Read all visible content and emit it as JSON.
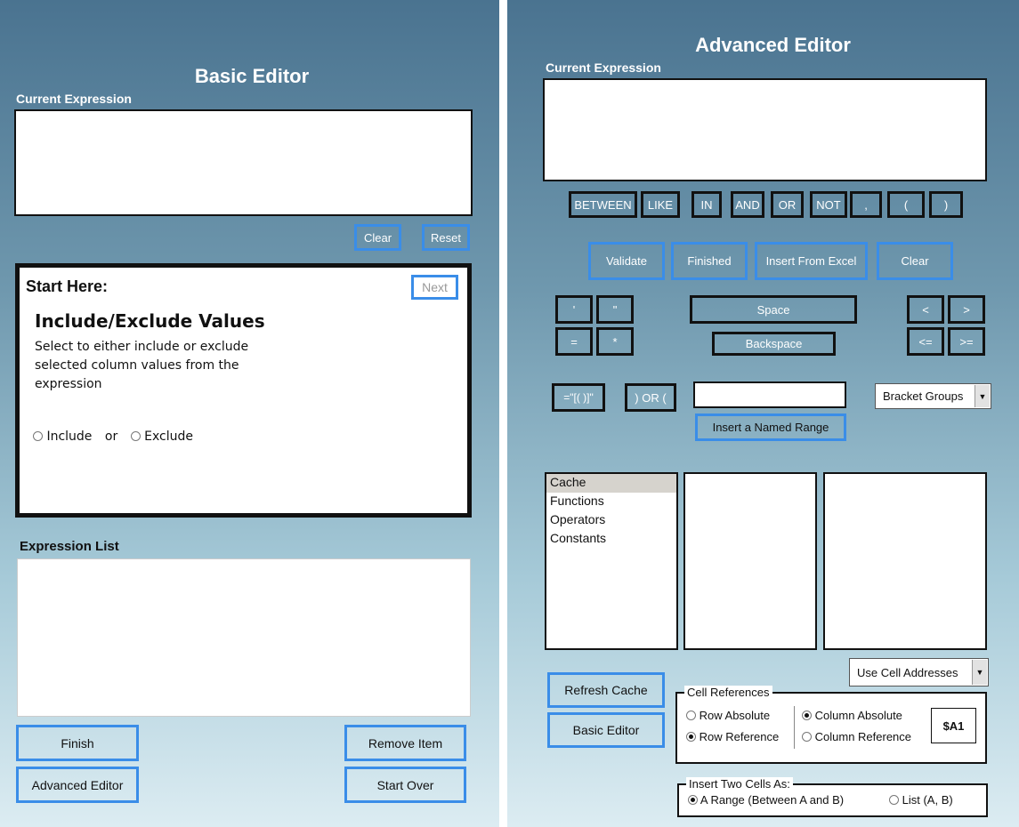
{
  "basic": {
    "title": "Basic Editor",
    "current_expression_label": "Current Expression",
    "clear_label": "Clear",
    "reset_label": "Reset",
    "start_here": "Start Here:",
    "next_label": "Next",
    "step_title": "Include/Exclude Values",
    "step_desc": "Select to either include or exclude selected column values from the expression",
    "include_label": "Include",
    "or_label": "or",
    "exclude_label": "Exclude",
    "expression_list_label": "Expression List",
    "finish_label": "Finish",
    "remove_item_label": "Remove Item",
    "advanced_editor_label": "Advanced Editor",
    "start_over_label": "Start Over"
  },
  "advanced": {
    "title": "Advanced Editor",
    "current_expression_label": "Current Expression",
    "operators": [
      "BETWEEN",
      "LIKE",
      "IN",
      "AND",
      "OR",
      "NOT",
      ",",
      "(",
      ")"
    ],
    "validate_label": "Validate",
    "finished_label": "Finished",
    "insert_from_excel_label": "Insert From Excel",
    "clear_label": "Clear",
    "quote_single": "'",
    "quote_double": "\"",
    "equals": "=",
    "star": "*",
    "space_label": "Space",
    "backspace_label": "Backspace",
    "lt": "<",
    "gt": ">",
    "lte": "<=",
    "gte": ">=",
    "bracket_insert": "=\"[( )]\"",
    "or_paren": ") OR (",
    "named_range_value": "",
    "bracket_groups_label": "Bracket Groups",
    "insert_named_range_label": "Insert a Named Range",
    "list_items": [
      "Cache",
      "Functions",
      "Operators",
      "Constants"
    ],
    "use_cell_addresses_label": "Use Cell Addresses",
    "refresh_cache_label": "Refresh Cache",
    "basic_editor_label": "Basic Editor",
    "cell_references_legend": "Cell References",
    "row_absolute": "Row Absolute",
    "row_reference": "Row Reference",
    "column_absolute": "Column Absolute",
    "column_reference": "Column Reference",
    "cell_preview": "$A1",
    "insert_two_cells_legend": "Insert Two Cells As:",
    "a_range_label": "A Range (Between A and B)",
    "list_label": "List (A, B)"
  },
  "colors": {
    "accent_blue": "#3a8de8",
    "panel_top": "#4a7390",
    "panel_bottom": "#dcecf2"
  }
}
